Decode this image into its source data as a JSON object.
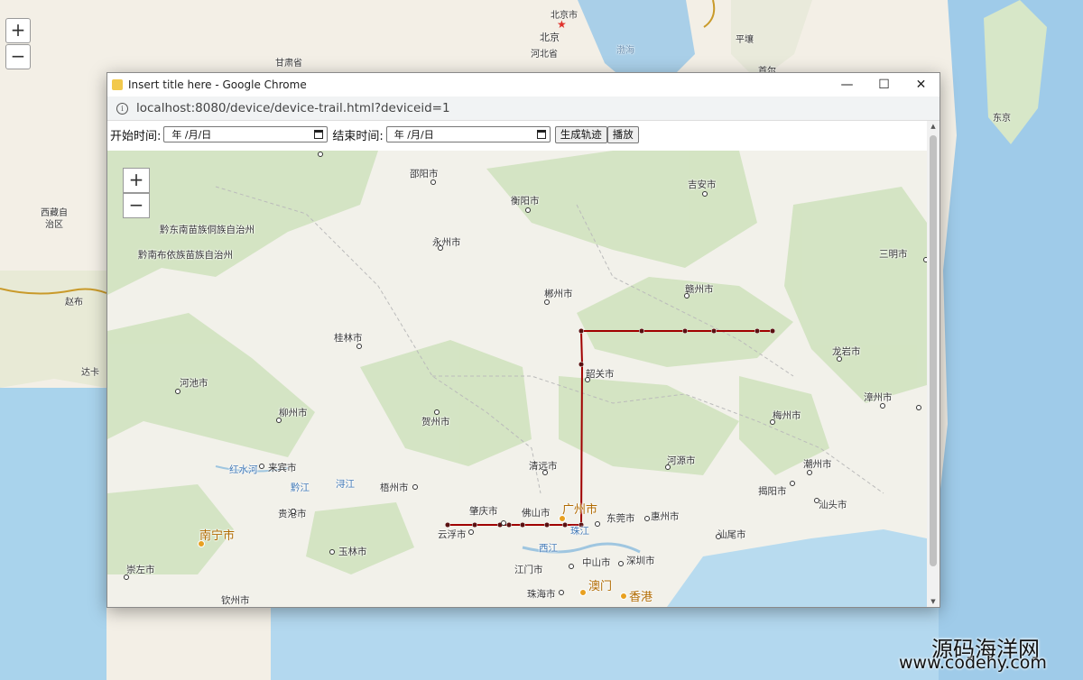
{
  "background_map": {
    "zoom_in": "+",
    "zoom_out": "−",
    "labels": [
      "北京市",
      "北京",
      "河北省",
      "甘肃省",
      "渤海",
      "平壤",
      "首尔",
      "东京",
      "西藏自治区",
      "赵布",
      "达卡"
    ],
    "watermark": "源码海洋网",
    "watermark_url": "www.codehy.com"
  },
  "window": {
    "title": "Insert title here - Google Chrome",
    "minimize": "—",
    "maximize": "☐",
    "close": "✕",
    "url": "localhost:8080/device/device-trail.html?deviceid=1"
  },
  "form": {
    "start_label": "开始时间:",
    "start_value": "年 /月/日",
    "end_label": "结束时间:",
    "end_value": "年 /月/日",
    "generate_button": "生成轨迹",
    "play_button": "播放"
  },
  "map": {
    "zoom_in": "+",
    "zoom_out": "−",
    "cities": [
      "邵阳市",
      "衡阳市",
      "吉安市",
      "永州市",
      "三明市",
      "黔东南苗族侗族自治州",
      "黔南布依族苗族自治州",
      "郴州市",
      "赣州市",
      "桂林市",
      "龙岩市",
      "韶关市",
      "河池市",
      "漳州市",
      "柳州市",
      "贺州市",
      "梅州市",
      "清远市",
      "河源市",
      "潮州市",
      "揭阳市",
      "汕头市",
      "红水河",
      "来宾市",
      "黔江",
      "浔江",
      "梧州市",
      "肇庆市",
      "佛山市",
      "广州市",
      "东莞市",
      "惠州市",
      "贵港市",
      "云浮市",
      "珠江",
      "汕尾市",
      "南宁市",
      "玉林市",
      "西江",
      "江门市",
      "中山市",
      "深圳市",
      "崇左市",
      "澳门",
      "香港",
      "珠海市",
      "钦州市"
    ],
    "trail_color": "#a00000"
  }
}
